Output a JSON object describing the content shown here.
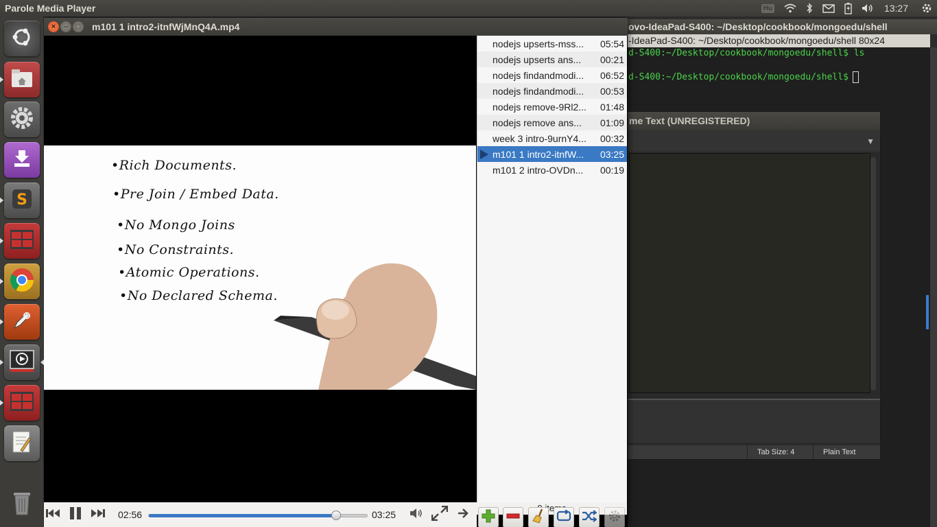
{
  "top_panel": {
    "app_name": "Parole Media Player",
    "keyboard_layout": "Hu",
    "clock": "13:27"
  },
  "launcher": {
    "items": [
      {
        "name": "dash-home",
        "icon": "ubuntu-logo-icon"
      },
      {
        "name": "files",
        "icon": "home-folder-icon"
      },
      {
        "name": "system-settings",
        "icon": "gear-icon"
      },
      {
        "name": "software-center",
        "icon": "download-arrow-icon"
      },
      {
        "name": "sublime-text",
        "icon": "sublime-s-icon"
      },
      {
        "name": "terminal-1",
        "icon": "terminal-icon"
      },
      {
        "name": "chrome",
        "icon": "chrome-icon"
      },
      {
        "name": "inkscape",
        "icon": "pen-icon"
      },
      {
        "name": "parole",
        "icon": "media-player-icon"
      },
      {
        "name": "terminal-2",
        "icon": "terminal-icon"
      },
      {
        "name": "text-editor",
        "icon": "notepad-icon"
      },
      {
        "name": "trash",
        "icon": "trash-icon"
      }
    ]
  },
  "terminal": {
    "title": "ovo-IdeaPad-S400: ~/Desktop/cookbook/mongoedu/shell",
    "tab_title": "-IdeaPad-S400: ~/Desktop/cookbook/mongoedu/shell 80x24",
    "line1": "d-S400:~/Desktop/cookbook/mongoedu/shell$ ls",
    "line2": "d-S400:~/Desktop/cookbook/mongoedu/shell$"
  },
  "sublime": {
    "title": "me Text (UNREGISTERED)",
    "tab_size": "Tab Size: 4",
    "syntax": "Plain Text"
  },
  "parole": {
    "title": "m101 1 intro2-itnfWjMnQ4A.mp4",
    "whiteboard": [
      "•Rich Documents.",
      "•Pre Join / Embed Data.",
      "•No Mongo Joins",
      "•No Constraints.",
      "•Atomic Operations.",
      "•No Declared Schema."
    ],
    "playlist": [
      {
        "name": "nodejs upserts-mss...",
        "duration": "05:54"
      },
      {
        "name": "nodejs upserts ans...",
        "duration": "00:21"
      },
      {
        "name": "nodejs findandmodi...",
        "duration": "06:52"
      },
      {
        "name": "nodejs findandmodi...",
        "duration": "00:53"
      },
      {
        "name": "nodejs remove-9Rl2...",
        "duration": "01:48"
      },
      {
        "name": "nodejs remove ans...",
        "duration": "01:09"
      },
      {
        "name": "week 3 intro-9urnY4...",
        "duration": "00:32"
      },
      {
        "name": "m101 1 intro2-itnfW...",
        "duration": "03:25"
      },
      {
        "name": "m101 2 intro-OVDn...",
        "duration": "00:19"
      }
    ],
    "playing_index": 7,
    "item_count": "9 items",
    "elapsed": "02:56",
    "total": "03:25",
    "progress": 0.859,
    "accent_color": "#3a79c4"
  }
}
